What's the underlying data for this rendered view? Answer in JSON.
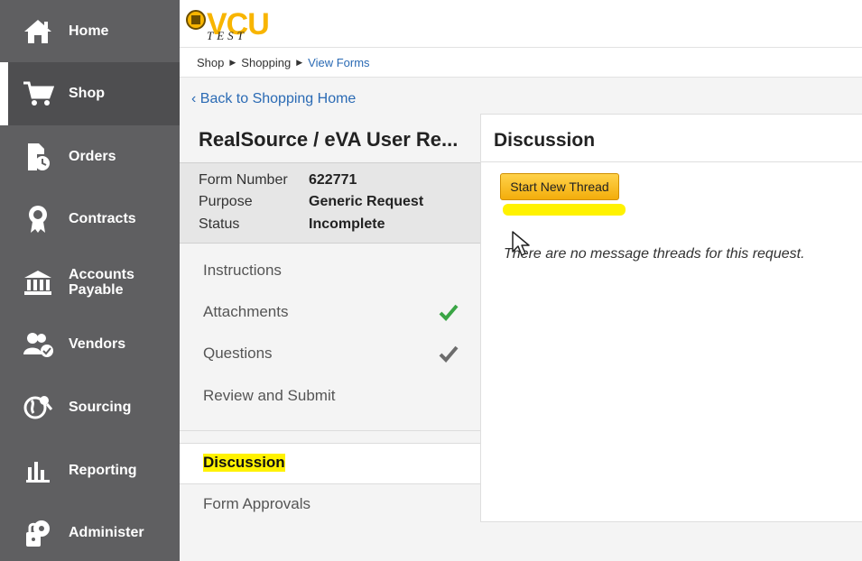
{
  "nav": {
    "items": [
      {
        "label": "Home",
        "icon": "home-icon"
      },
      {
        "label": "Shop",
        "icon": "cart-icon",
        "active": true
      },
      {
        "label": "Orders",
        "icon": "orders-icon"
      },
      {
        "label": "Contracts",
        "icon": "contracts-icon"
      },
      {
        "label": "Accounts Payable",
        "icon": "bank-icon"
      },
      {
        "label": "Vendors",
        "icon": "vendors-icon"
      },
      {
        "label": "Sourcing",
        "icon": "sourcing-icon"
      },
      {
        "label": "Reporting",
        "icon": "reporting-icon"
      },
      {
        "label": "Administer",
        "icon": "administer-icon"
      }
    ]
  },
  "header": {
    "logo": {
      "brand": "VCU",
      "subtitle": "TEST",
      "brand_color": "#f8b500"
    }
  },
  "breadcrumb": {
    "items": [
      "Shop",
      "Shopping",
      "View Forms"
    ]
  },
  "back_link": "Back to Shopping Home",
  "form": {
    "title": "RealSource / eVA User Re...",
    "meta": [
      {
        "key": "Form Number",
        "value": "622771"
      },
      {
        "key": "Purpose",
        "value": "Generic Request"
      },
      {
        "key": "Status",
        "value": "Incomplete"
      }
    ],
    "steps": [
      {
        "label": "Instructions",
        "check": "none"
      },
      {
        "label": "Attachments",
        "check": "complete"
      },
      {
        "label": "Questions",
        "check": "done-gray"
      },
      {
        "label": "Review and Submit",
        "check": "none"
      }
    ],
    "sections": [
      {
        "label": "Discussion",
        "active": true
      },
      {
        "label": "Form Approvals"
      }
    ]
  },
  "discussion": {
    "title": "Discussion",
    "button_label": "Start New Thread",
    "empty_message": "There are no message threads for this request."
  },
  "colors": {
    "nav_bg": "#5f5f61",
    "link": "#2a6ab4",
    "button": "#f8b600",
    "check_green": "#3aa545",
    "check_gray": "#6c6c6c",
    "highlight": "#fff200"
  }
}
